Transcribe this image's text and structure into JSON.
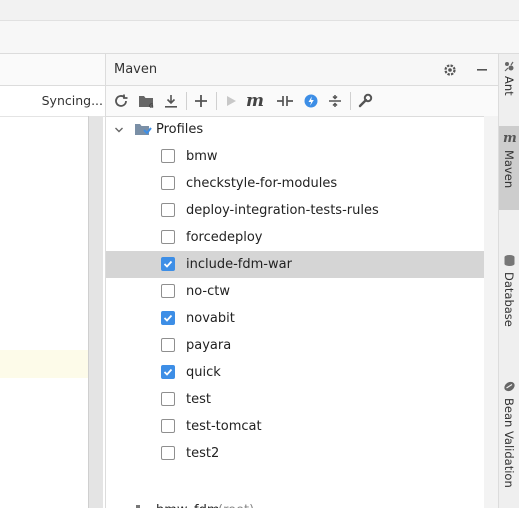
{
  "left": {
    "status": "Syncing..."
  },
  "maven": {
    "title": "Maven",
    "tree": {
      "profiles_label": "Profiles",
      "profiles": [
        {
          "name": "bmw",
          "checked": false,
          "selected": false
        },
        {
          "name": "checkstyle-for-modules",
          "checked": false,
          "selected": false
        },
        {
          "name": "deploy-integration-tests-rules",
          "checked": false,
          "selected": false
        },
        {
          "name": "forcedeploy",
          "checked": false,
          "selected": false
        },
        {
          "name": "include-fdm-war",
          "checked": true,
          "selected": true
        },
        {
          "name": "no-ctw",
          "checked": false,
          "selected": false
        },
        {
          "name": "novabit",
          "checked": true,
          "selected": false
        },
        {
          "name": "payara",
          "checked": false,
          "selected": false
        },
        {
          "name": "quick",
          "checked": true,
          "selected": false
        },
        {
          "name": "test",
          "checked": false,
          "selected": false
        },
        {
          "name": "test-tomcat",
          "checked": false,
          "selected": false
        },
        {
          "name": "test2",
          "checked": false,
          "selected": false
        }
      ],
      "project_name": "bmw_fdm",
      "project_suffix": "(root)"
    },
    "toolbar": {
      "m_label": "m"
    }
  },
  "right_strip": {
    "tabs": [
      {
        "label": "Ant",
        "icon": "ant-icon"
      },
      {
        "label": "Maven",
        "icon": "maven-icon",
        "active": true
      },
      {
        "label": "Database",
        "icon": "database-icon"
      },
      {
        "label": "Bean Validation",
        "icon": "bean-validation-icon"
      }
    ]
  },
  "colors": {
    "accent": "#3d8ee6",
    "selection": "#d5d5d5"
  }
}
